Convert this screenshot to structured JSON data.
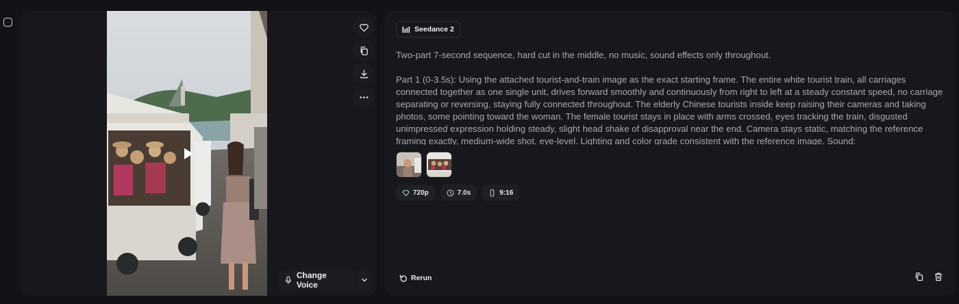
{
  "player": {
    "voice_label": "Change Voice"
  },
  "detail": {
    "model_label": "Seedance 2",
    "prompt_intro": "Two-part 7-second sequence, hard cut in the middle, no music, sound effects only throughout.",
    "prompt_part1": "Part 1 (0-3.5s): Using the attached tourist-and-train image as the exact starting frame. The entire white tourist train, all carriages connected together as one single unit, drives forward smoothly and continuously from right to left at a steady constant speed, no carriage separating or reversing, staying fully connected throughout. The elderly Chinese tourists inside keep raising their cameras and taking photos, some pointing toward the woman. The female tourist stays in place with arms crossed, eyes tracking the train, disgusted unimpressed expression holding steady, slight head shake of disapproval near the end. Camera stays static, matching the reference framing exactly, medium-wide shot, eye-level. Lighting and color grade consistent with the reference image. Sound:",
    "chips": {
      "resolution": "720p",
      "duration": "7.0s",
      "aspect": "9:16"
    },
    "rerun_label": "Rerun"
  },
  "icons": {
    "side_actions": [
      "heart-icon",
      "copy-icon",
      "download-icon",
      "more-icon"
    ],
    "footer": [
      "copy-icon",
      "trash-icon"
    ]
  },
  "colors": {
    "background": "#121316",
    "panel": "#17181b",
    "text_muted": "#a9aaaf",
    "text_bright": "#f0f0f0"
  }
}
